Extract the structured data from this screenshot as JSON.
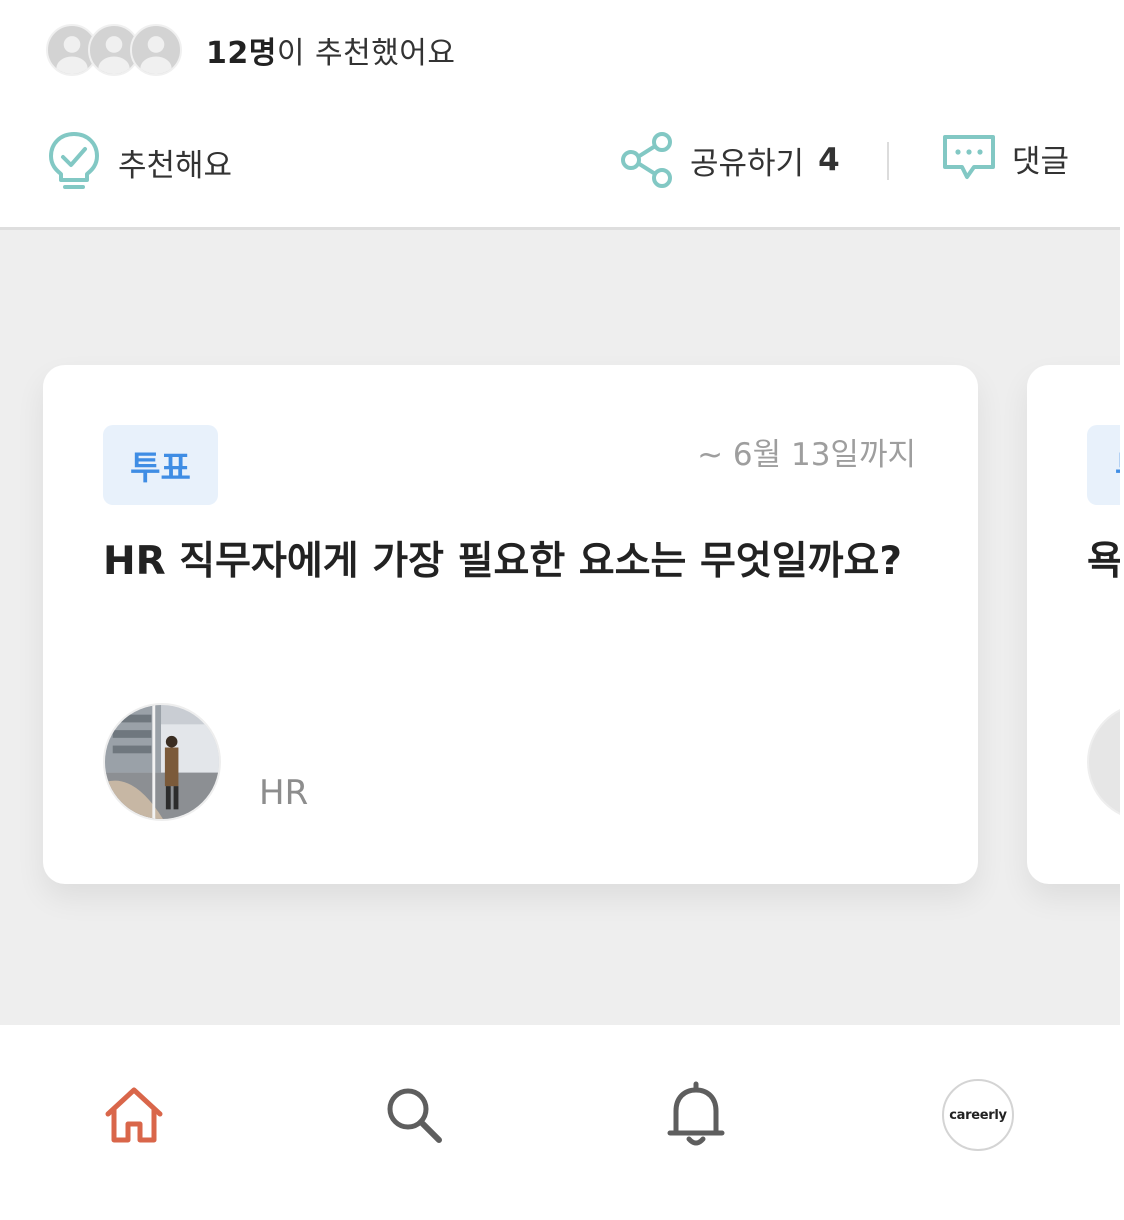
{
  "recommend": {
    "count": "12명",
    "suffix": "이 추천했어요"
  },
  "actions": {
    "recommend_label": "추천해요",
    "share_label": "공유하기",
    "share_count": "4",
    "comment_label": "댓글"
  },
  "card": {
    "badge": "투표",
    "deadline": "~ 6월 13일까지",
    "question": "HR 직무자에게 가장 필요한 요소는 무엇일까요?",
    "author_name": "",
    "author_role": "HR"
  },
  "next_card": {
    "badge": "투",
    "title": "욕"
  },
  "nav": {
    "items": [
      "home-icon",
      "search-icon",
      "bell-icon",
      "profile-button"
    ],
    "brand": "careerly",
    "active_color": "#d9664a"
  },
  "colors": {
    "accent_teal": "#82c8c4",
    "vote_blue": "#3f8de4"
  }
}
